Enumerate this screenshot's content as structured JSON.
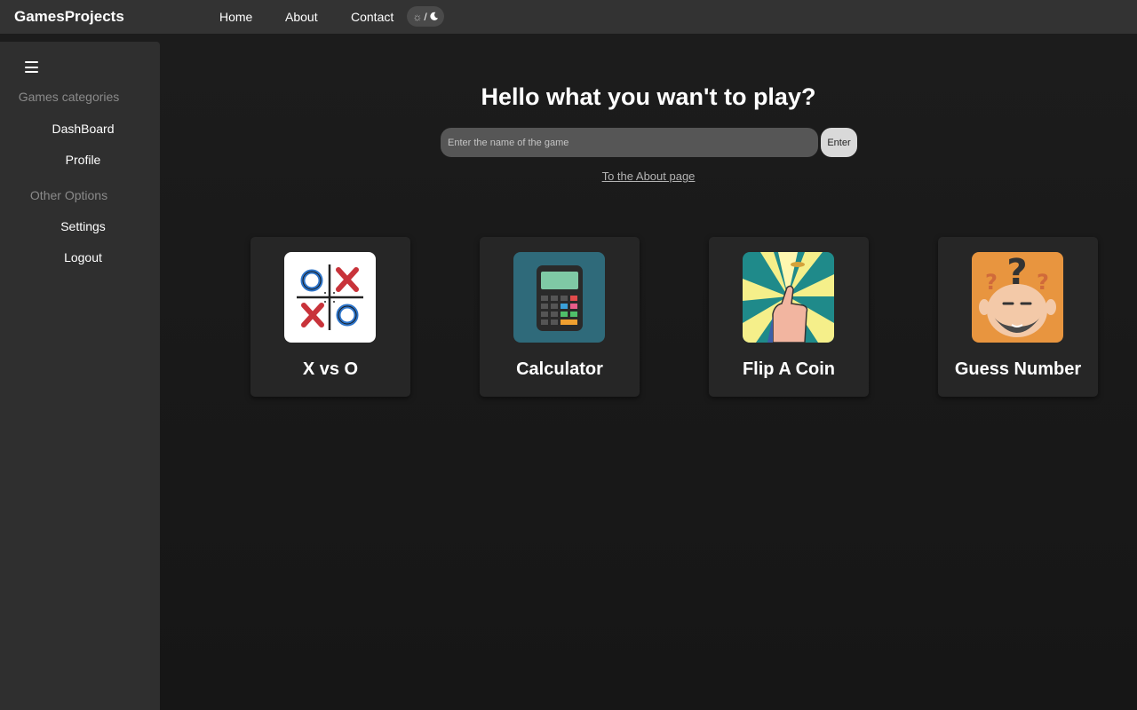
{
  "header": {
    "brand": "GamesProjects",
    "nav": [
      {
        "label": "Home"
      },
      {
        "label": "About"
      },
      {
        "label": "Contact"
      }
    ],
    "theme_toggle": {
      "sun_icon": "sun-icon",
      "separator": "/",
      "moon_icon": "moon-icon"
    }
  },
  "sidebar": {
    "menu_icon": "hamburger-menu-icon",
    "sections": [
      {
        "heading": "Games categories",
        "items": [
          {
            "label": "DashBoard"
          },
          {
            "label": "Profile"
          }
        ]
      },
      {
        "heading": "Other Options",
        "items": [
          {
            "label": "Settings"
          },
          {
            "label": "Logout"
          }
        ]
      }
    ]
  },
  "main": {
    "headline": "Hello what you wan't to play?",
    "search": {
      "placeholder": "Enter the name of the game",
      "value": "",
      "button_label": "Enter"
    },
    "about_link": "To the About page",
    "games": [
      {
        "title": "X vs O",
        "icon": "tic-tac-toe-icon"
      },
      {
        "title": "Calculator",
        "icon": "calculator-icon"
      },
      {
        "title": "Flip A Coin",
        "icon": "coin-flip-icon"
      },
      {
        "title": "Guess Number",
        "icon": "guess-number-icon"
      }
    ]
  },
  "colors": {
    "topbar_bg": "#333333",
    "sidebar_bg": "#2f2f2f",
    "main_bg": "#1c1c1c",
    "card_bg": "#262626",
    "search_bg": "#565656",
    "enter_btn_bg": "#d9d9d9"
  }
}
